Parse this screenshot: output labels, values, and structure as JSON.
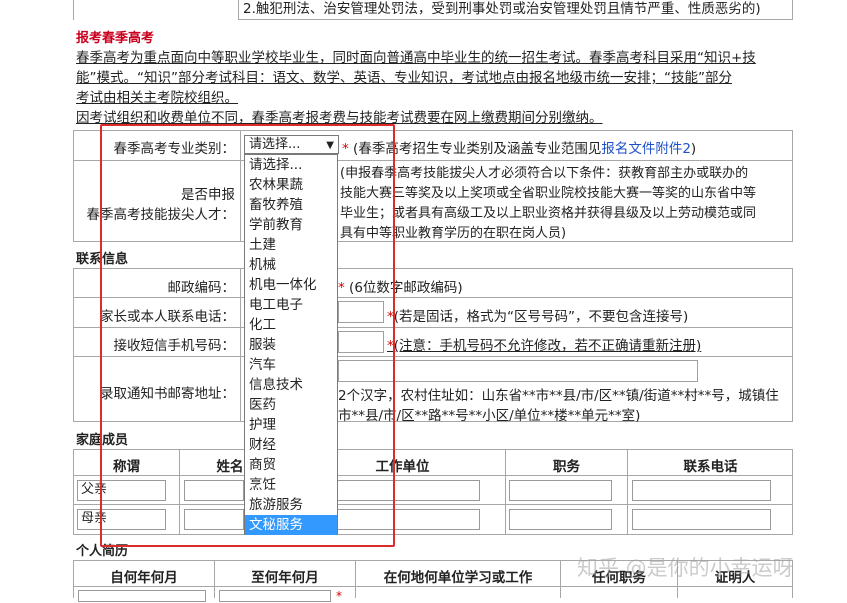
{
  "top_note": "2.触犯刑法、治安管理处罚法，受到刑事处罚或治安管理处罚且情节严重、性质恶劣的)",
  "spring_title": "报考春季高考",
  "intro_lines": [
    "春季高考为重点面向中等职业学校毕业生，同时面向普通高中毕业生的统一招生考试。春季高考科目采用“知识+技",
    "能”模式。“知识”部分考试科目：语文、数学、英语、专业知识，考试地点由报名地级市统一安排；“技能”部分",
    "考试由相关主考院校组织。"
  ],
  "fee_note": "因考试组织和收费单位不同，春季高考报考费与技能考试费要在网上缴费期间分别缴纳。",
  "category": {
    "label": "春季高考专业类别：",
    "selected": "请选择...",
    "hint_prefix": "(春季高考招生专业类别及涵盖专业范围见",
    "hint_link": "报名文件附件2",
    "hint_suffix": ")",
    "options": [
      "请选择...",
      "农林果蔬",
      "畜牧养殖",
      "学前教育",
      "土建",
      "机械",
      "机电一体化",
      "电工电子",
      "化工",
      "服装",
      "汽车",
      "信息技术",
      "医药",
      "护理",
      "财经",
      "商贸",
      "烹饪",
      "旅游服务",
      "文秘服务"
    ],
    "highlighted": "文秘服务"
  },
  "talent": {
    "label_line1": "是否申报",
    "label_line2": "春季高考技能拔尖人才：",
    "hint_lines": [
      "(申报春季高考技能拔尖人才必须符合以下条件：获教育部主办或联办的",
      "技能大赛三等奖及以上奖项或全省职业院校技能大赛一等奖的山东省中等",
      "毕业生；或者具有高级工及以上职业资格并获得县级及以上劳动模范或同",
      "具有中等职业教育学历的在职在岗人员)"
    ]
  },
  "contact": {
    "section": "联系信息",
    "postcode_label": "邮政编码：",
    "postcode_hint": "(6位数字邮政编码)",
    "phone_label": "家长或本人联系电话：",
    "phone_hint": "(若是固话，格式为“区号号码”，不要包含连接号)",
    "sms_label": "接收短信手机号码：",
    "sms_hint": "(注意：手机号码不允许修改，若不正确请重新注册)",
    "address_label": "录取通知书邮寄地址：",
    "address_hint_line1": "2个汉字，农村住址如：山东省**市**县/市/区**镇/街道**村**号，城镇住",
    "address_hint_line2": "市**县/市/区**路**号**小区/单位**楼**单元**室)"
  },
  "family": {
    "section": "家庭成员",
    "headers": [
      "称谓",
      "姓名",
      "工作单位",
      "职务",
      "联系电话"
    ],
    "rows": [
      {
        "relation": "父亲"
      },
      {
        "relation": "母亲"
      }
    ]
  },
  "resume": {
    "section": "个人简历",
    "headers": [
      "自何年何月",
      "至何年何月",
      "在何地何单位学习或工作",
      "任何职务",
      "证明人"
    ]
  },
  "watermark": "知乎 @是你的小幸运呀",
  "colors": {
    "title_red": "#c8001e",
    "link_blue": "#1e50c8",
    "highlight_blue": "#3399ff",
    "annotation_red": "#dd2a2a",
    "border_gray": "#a7a7a7"
  }
}
